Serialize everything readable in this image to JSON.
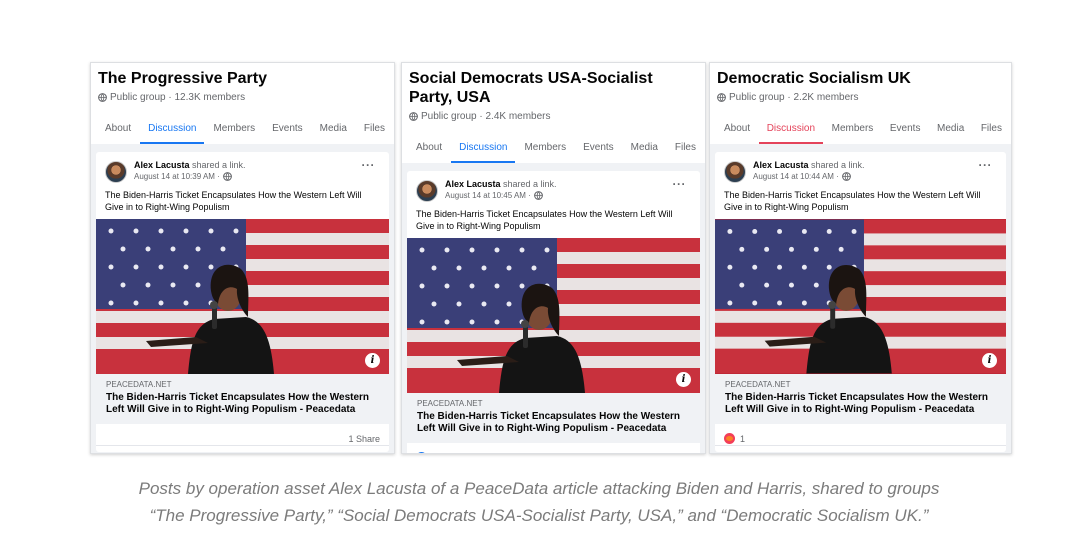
{
  "panels": [
    {
      "group_name": "The Progressive Party",
      "group_meta": "Public group · 12.3K members",
      "tabs": [
        "About",
        "Discussion",
        "Members",
        "Events",
        "Media",
        "Files"
      ],
      "active_tab": "Discussion",
      "post": {
        "author": "Alex Lacusta",
        "action": " shared a link.",
        "time": "August 14 at 10:39 AM ·",
        "text": "The Biden-Harris Ticket Encapsulates How the Western Left Will Give in to Right-Wing Populism",
        "link_domain": "PEACEDATA.NET",
        "link_title": "The Biden-Harris Ticket Encapsulates How the Western Left Will Give in to Right-Wing Populism - Peacedata",
        "footer_left": "",
        "footer_right": "1 Share"
      }
    },
    {
      "group_name": "Social Democrats USA-Socialist Party, USA",
      "group_meta": "Public group · 2.4K members",
      "tabs": [
        "About",
        "Discussion",
        "Members",
        "Events",
        "Media",
        "Files"
      ],
      "active_tab": "Discussion",
      "post": {
        "author": "Alex Lacusta",
        "action": " shared a link.",
        "time": "August 14 at 10:45 AM ·",
        "text": "The Biden-Harris Ticket Encapsulates How the Western Left Will Give in to Right-Wing Populism",
        "link_domain": "PEACEDATA.NET",
        "link_title": "The Biden-Harris Ticket Encapsulates How the Western Left Will Give in to Right-Wing Populism - Peacedata",
        "footer_left": "",
        "footer_right": ""
      }
    },
    {
      "group_name": "Democratic Socialism UK",
      "group_meta": "Public group · 2.2K members",
      "tabs": [
        "About",
        "Discussion",
        "Members",
        "Events",
        "Media",
        "Files"
      ],
      "active_tab": "Discussion",
      "post": {
        "author": "Alex Lacusta",
        "action": " shared a link.",
        "time": "August 14 at 10:44 AM ·",
        "text": "The Biden-Harris Ticket Encapsulates How the Western Left Will Give in to Right-Wing Populism",
        "link_domain": "PEACEDATA.NET",
        "link_title": "The Biden-Harris Ticket Encapsulates How the Western Left Will Give in to Right-Wing Populism - Peacedata",
        "footer_left": "1",
        "footer_right": ""
      }
    }
  ],
  "caption": {
    "line1": "Posts by operation asset Alex Lacusta of a PeaceData article attacking Biden and Harris, shared to groups",
    "line2": "“The Progressive Party,” “Social Democrats USA-Socialist Party, USA,” and “Democratic Socialism UK.”"
  },
  "icons": {
    "group_privacy": "globe-icon",
    "post_privacy": "globe-icon",
    "post_menu": "more-options-icon",
    "image_info": "info-icon",
    "reaction_panel3": "angry-reaction-icon"
  },
  "colors": {
    "facebook_blue": "#1877f2",
    "active_tab_panel3": "#e4435a",
    "text_primary": "#050505",
    "text_secondary": "#65676b",
    "caption": "#7b7b7b"
  }
}
